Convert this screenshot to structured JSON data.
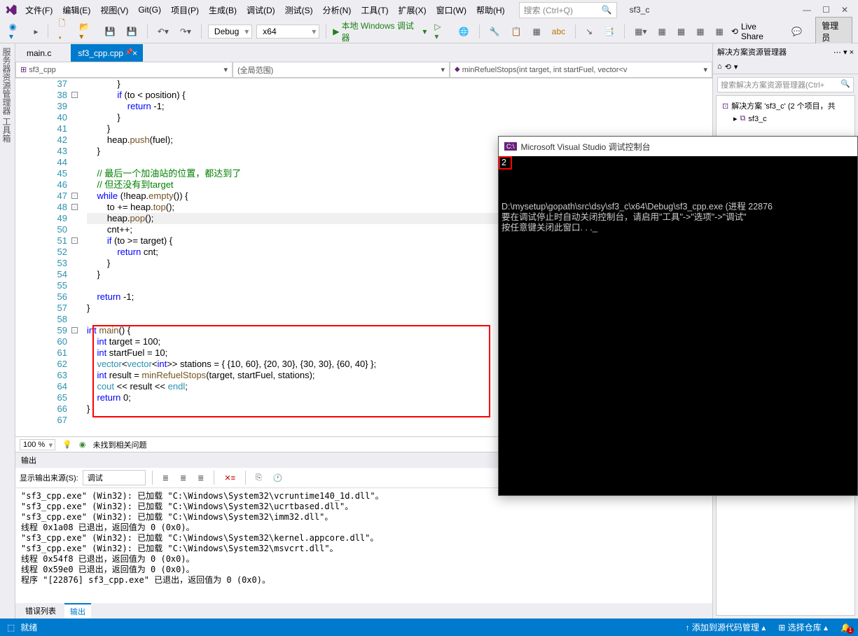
{
  "menu": {
    "file": "文件(F)",
    "edit": "编辑(E)",
    "view": "视图(V)",
    "git": "Git(G)",
    "project": "项目(P)",
    "build": "生成(B)",
    "debug": "调试(D)",
    "test": "测试(S)",
    "analyze": "分析(N)",
    "tools": "工具(T)",
    "extensions": "扩展(X)",
    "window": "窗口(W)",
    "help": "帮助(H)"
  },
  "search_placeholder": "搜索 (Ctrl+Q)",
  "project_name": "sf3_c",
  "toolbar": {
    "config": "Debug",
    "platform": "x64",
    "run": "本地 Windows 调试器",
    "liveshare": "Live Share",
    "admin": "管理员"
  },
  "tabs": {
    "inactive": "main.c",
    "active": "sf3_cpp.cpp"
  },
  "nav": {
    "scope": "sf3_cpp",
    "type": "(全局范围)",
    "func": "minRefuelStops(int target, int startFuel, vector<v"
  },
  "code_start_line": 37,
  "highlight_line": 49,
  "code_lines": [
    {
      "t": "            }"
    },
    {
      "t": "            <kw>if</kw> (to < position) {"
    },
    {
      "t": "                <kw>return</kw> -1;"
    },
    {
      "t": "            }"
    },
    {
      "t": "        }"
    },
    {
      "t": "        heap.<fn>push</fn>(fuel);"
    },
    {
      "t": "    }"
    },
    {
      "t": ""
    },
    {
      "t": "    <cm>// 最后一个加油站的位置，都达到了</cm>"
    },
    {
      "t": "    <cm>// 但还没有到target</cm>"
    },
    {
      "t": "    <kw>while</kw> (!heap.<fn>empty</fn>()) {"
    },
    {
      "t": "        to += heap.<fn>top</fn>();"
    },
    {
      "t": "        heap.<fn>pop</fn>();"
    },
    {
      "t": "        cnt++;"
    },
    {
      "t": "        <kw>if</kw> (to >= target) {"
    },
    {
      "t": "            <kw>return</kw> cnt;"
    },
    {
      "t": "        }"
    },
    {
      "t": "    }"
    },
    {
      "t": ""
    },
    {
      "t": "    <kw>return</kw> -1;"
    },
    {
      "t": "}"
    },
    {
      "t": ""
    },
    {
      "t": "<kw>int</kw> <fn>main</fn>() {"
    },
    {
      "t": "    <kw>int</kw> target = 100;"
    },
    {
      "t": "    <kw>int</kw> startFuel = 10;"
    },
    {
      "t": "    <typ>vector</typ>&lt;<typ>vector</typ>&lt;<kw>int</kw>&gt;&gt; stations = { {10, 60}, {20, 30}, {30, 30}, {60, 40} };"
    },
    {
      "t": "    <kw>int</kw> result = <fn>minRefuelStops</fn>(target, startFuel, stations);"
    },
    {
      "t": "    <typ>cout</typ> &lt;&lt; result &lt;&lt; <typ>endl</typ>;"
    },
    {
      "t": "    <kw>return</kw> 0;"
    },
    {
      "t": "}"
    },
    {
      "t": ""
    }
  ],
  "zoom": "100 %",
  "issues": "未找到相关问题",
  "output": {
    "title": "输出",
    "source_label": "显示输出来源(S):",
    "source": "调试",
    "lines": [
      "\"sf3_cpp.exe\" (Win32): 已加载 \"C:\\Windows\\System32\\vcruntime140_1d.dll\"。",
      "\"sf3_cpp.exe\" (Win32): 已加载 \"C:\\Windows\\System32\\ucrtbased.dll\"。",
      "\"sf3_cpp.exe\" (Win32): 已加载 \"C:\\Windows\\System32\\imm32.dll\"。",
      "线程 0x1a08 已退出，返回值为 0 (0x0)。",
      "\"sf3_cpp.exe\" (Win32): 已加载 \"C:\\Windows\\System32\\kernel.appcore.dll\"。",
      "\"sf3_cpp.exe\" (Win32): 已加载 \"C:\\Windows\\System32\\msvcrt.dll\"。",
      "线程 0x54f8 已退出，返回值为 0 (0x0)。",
      "线程 0x59e0 已退出，返回值为 0 (0x0)。",
      "程序 \"[22876] sf3_cpp.exe\" 已退出，返回值为 0 (0x0)。"
    ]
  },
  "bottom_tabs": {
    "errors": "错误列表",
    "output": "输出"
  },
  "right": {
    "title": "解决方案资源管理器",
    "search_ph": "搜索解决方案资源管理器(Ctrl+",
    "solution": "解决方案 'sf3_c' (2 个项目，共",
    "project": "sf3_c"
  },
  "console": {
    "title": "Microsoft Visual Studio 调试控制台",
    "output": "2",
    "body": "D:\\mysetup\\gopath\\src\\dsy\\sf3_c\\x64\\Debug\\sf3_cpp.exe (进程 22876\n要在调试停止时自动关闭控制台，请启用\"工具\"->\"选项\"->\"调试\"\n按任意键关闭此窗口. . ._"
  },
  "statusbar": {
    "ready": "就绪",
    "src_ctrl": "添加到源代码管理",
    "repo": "选择仓库",
    "notif": "1"
  }
}
